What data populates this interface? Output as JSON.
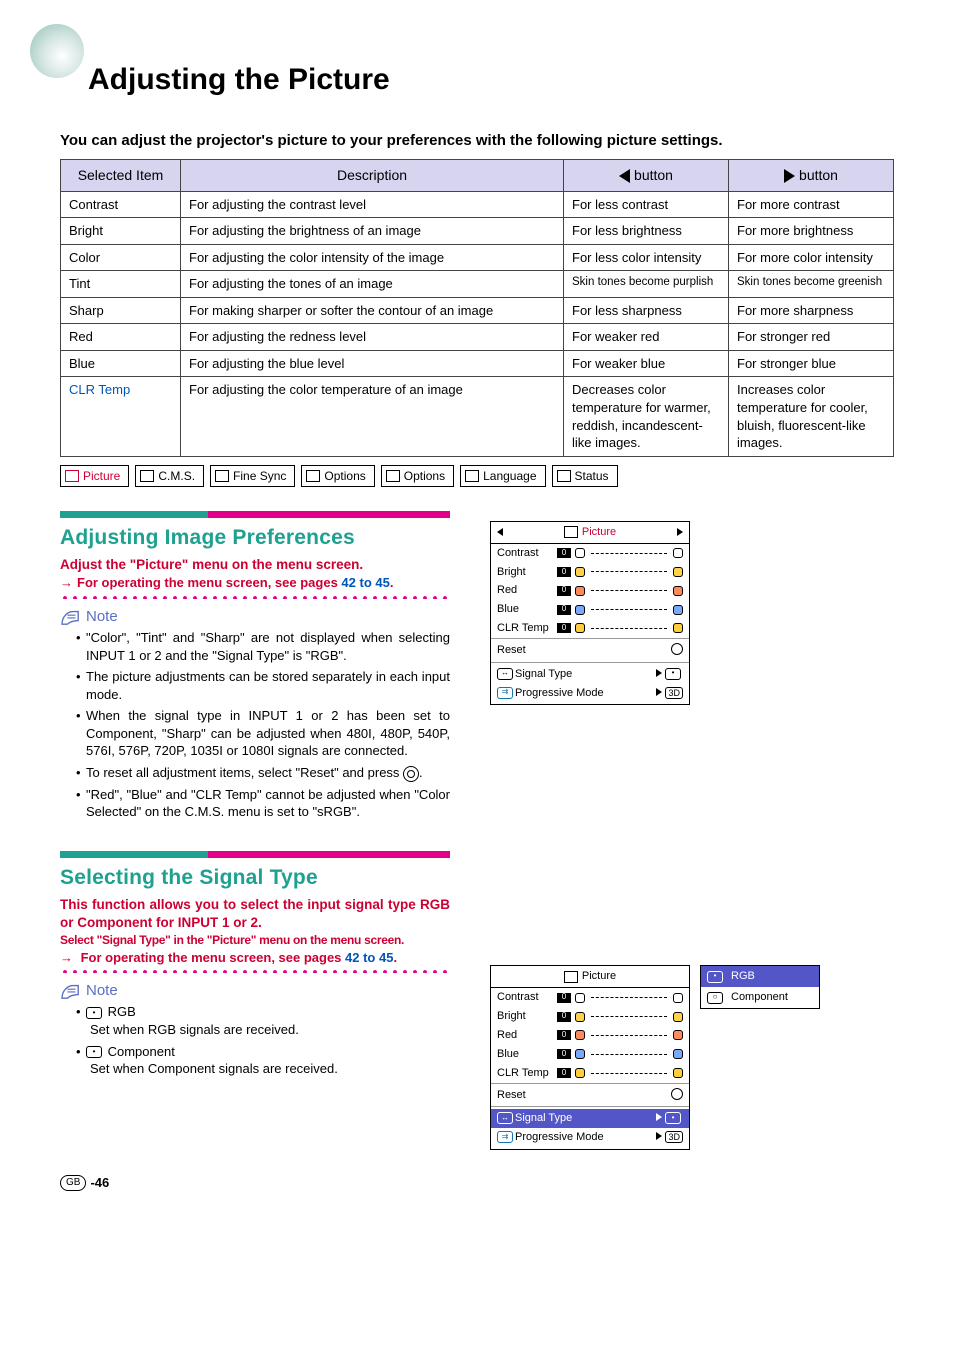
{
  "page_title": "Adjusting the Picture",
  "intro": "You can adjust the projector's picture to your preferences with the following picture settings.",
  "table": {
    "headers": {
      "item": "Selected Item",
      "desc": "Description",
      "left": "button",
      "right": "button"
    },
    "rows": [
      {
        "item": "Contrast",
        "desc": "For adjusting the contrast level",
        "left": "For less contrast",
        "right": "For more contrast"
      },
      {
        "item": "Bright",
        "desc": "For adjusting the brightness of an image",
        "left": "For less brightness",
        "right": "For more brightness"
      },
      {
        "item": "Color",
        "desc": "For adjusting the color intensity of the image",
        "left": "For less color intensity",
        "right": "For more color intensity"
      },
      {
        "item": "Tint",
        "desc": "For adjusting the tones of an image",
        "left": "Skin tones become purplish",
        "right": "Skin tones become greenish",
        "small": true
      },
      {
        "item": "Sharp",
        "desc": "For making sharper or softer the contour of an image",
        "left": "For less sharpness",
        "right": "For more sharpness"
      },
      {
        "item": "Red",
        "desc": "For adjusting the redness level",
        "left": "For weaker red",
        "right": "For stronger red"
      },
      {
        "item": "Blue",
        "desc": "For adjusting the blue level",
        "left": "For weaker blue",
        "right": "For stronger blue"
      },
      {
        "item": "CLR Temp",
        "item_link": true,
        "desc": "For adjusting the color temperature of an image",
        "left": "Decreases color temperature for warmer, reddish, incandescent-like images.",
        "right": "Increases color temperature for cooler, bluish, fluorescent-like images."
      }
    ]
  },
  "menubar": [
    "Picture",
    "C.M.S.",
    "Fine Sync",
    "Options",
    "Options",
    "Language",
    "Status"
  ],
  "section1": {
    "title": "Adjusting Image Preferences",
    "subtitle": "Adjust the \"Picture\" menu on the menu screen.",
    "link_line_prefix": "For operating the menu screen, see pages ",
    "link_pages": "42 to 45",
    "link_suffix": ".",
    "note_label": "Note",
    "notes": [
      "\"Color\", \"Tint\" and \"Sharp\" are not displayed when selecting INPUT 1 or 2 and the \"Signal Type\" is \"RGB\".",
      "The picture adjustments can be stored separately in each input mode.",
      "When the signal type in INPUT 1 or 2 has been set to Component, \"Sharp\" can be adjusted when 480I, 480P, 540P, 576I, 576P, 720P, 1035I or 1080I signals are connected.",
      "To reset all adjustment items, select \"Reset\" and press ",
      "\"Red\", \"Blue\" and \"CLR Temp\" cannot be adjusted when \"Color Selected\" on the C.M.S. menu is set to \"sRGB\"."
    ]
  },
  "section2": {
    "title": "Selecting the Signal Type",
    "subtitle": "This function allows you to select the input signal type RGB or Component for INPUT 1 or 2.",
    "instruction": "Select \"Signal Type\" in the \"Picture\" menu on the menu screen.",
    "link_line_prefix": " For operating the menu screen, see pages ",
    "link_pages": "42 to 45",
    "link_suffix": ".",
    "note_label": "Note",
    "items": [
      {
        "name": "RGB",
        "desc": "Set when RGB signals are received."
      },
      {
        "name": "Component",
        "desc": "Set when Component signals are received."
      }
    ]
  },
  "osd": {
    "title": "Picture",
    "rows": [
      "Contrast",
      "Bright",
      "Red",
      "Blue",
      "CLR Temp"
    ],
    "val": "0",
    "reset": "Reset",
    "signal_type": "Signal Type",
    "progressive": "Progressive Mode",
    "chip_3d": "3D"
  },
  "sig_popup": {
    "rgb": "RGB",
    "component": "Component"
  },
  "footer_page": "-46",
  "footer_gb": "GB"
}
